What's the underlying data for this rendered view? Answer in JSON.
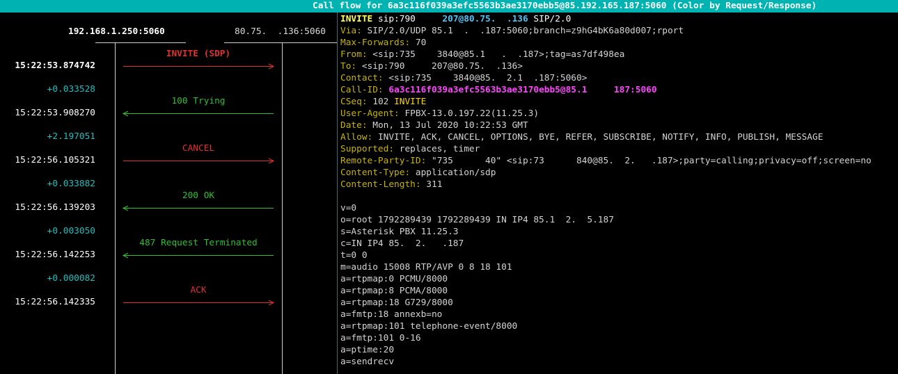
{
  "title": "Call flow for 6a3c116f039a3efc5563b3ae3170ebb5@85.192.165.187:5060 (Color by Request/Response)",
  "colors": {
    "title_bg": "#00b3b3",
    "request": "#e03030",
    "response": "#2ec02e",
    "delta": "#1fbfbf",
    "header_name": "#c8b400",
    "call_id": "#ff44ff"
  },
  "hosts": {
    "left": "192.168.1.250:5060",
    "right": "80.75.  .136:5060"
  },
  "flow": {
    "rows": [
      {
        "type": "label",
        "text": "INVITE (SDP)",
        "kind": "request",
        "bold": true
      },
      {
        "type": "time",
        "text": "15:22:53.874742",
        "bold": true
      },
      {
        "type": "arrow",
        "dir": "right",
        "kind": "request"
      },
      {
        "type": "delta",
        "text": "+0.033528"
      },
      {
        "type": "label",
        "text": "100 Trying",
        "kind": "response"
      },
      {
        "type": "time",
        "text": "15:22:53.908270"
      },
      {
        "type": "arrow",
        "dir": "left",
        "kind": "response"
      },
      {
        "type": "delta",
        "text": "+2.197051"
      },
      {
        "type": "label",
        "text": "CANCEL",
        "kind": "request"
      },
      {
        "type": "time",
        "text": "15:22:56.105321"
      },
      {
        "type": "arrow",
        "dir": "right",
        "kind": "request"
      },
      {
        "type": "delta",
        "text": "+0.033882"
      },
      {
        "type": "label",
        "text": "200 OK",
        "kind": "response"
      },
      {
        "type": "time",
        "text": "15:22:56.139203"
      },
      {
        "type": "arrow",
        "dir": "left",
        "kind": "response"
      },
      {
        "type": "delta",
        "text": "+0.003050"
      },
      {
        "type": "label",
        "text": "487 Request Terminated",
        "kind": "response"
      },
      {
        "type": "time",
        "text": "15:22:56.142253"
      },
      {
        "type": "arrow",
        "dir": "left",
        "kind": "response"
      },
      {
        "type": "delta",
        "text": "+0.000082"
      },
      {
        "type": "label",
        "text": "ACK",
        "kind": "request"
      },
      {
        "type": "time",
        "text": "15:22:56.142335"
      },
      {
        "type": "arrow",
        "dir": "right",
        "kind": "request"
      }
    ]
  },
  "sip": {
    "start_line": {
      "method": "INVITE",
      "uri_a": " sip:790     ",
      "uri_b": "207@80.75.  .136",
      "version": " SIP/2.0"
    },
    "headers": [
      {
        "name": "Via:",
        "value": " SIP/2.0/UDP 85.1  .  .187:5060;branch=z9hG4bK6a80d007;rport"
      },
      {
        "name": "Max-Forwards:",
        "value": " 70"
      },
      {
        "name": "From:",
        "value": " <sip:735    3840@85.1   .  .187>;tag=as7df498ea"
      },
      {
        "name": "To:",
        "value": " <sip:790     207@80.75.  .136>"
      },
      {
        "name": "Contact:",
        "value": " <sip:735    3840@85.  2.1  .187:5060>"
      },
      {
        "name": "Call-ID:",
        "value": " 6a3c116f039a3efc5563b3ae3170ebb5@85.1     187:5060",
        "style": "callid"
      },
      {
        "name": "CSeq:",
        "value": " 102 ",
        "method": "INVITE"
      },
      {
        "name": "User-Agent:",
        "value": " FPBX-13.0.197.22(11.25.3)"
      },
      {
        "name": "Date:",
        "value": " Mon, 13 Jul 2020 10:22:53 GMT"
      },
      {
        "name": "Allow:",
        "value": " INVITE, ACK, CANCEL, OPTIONS, BYE, REFER, SUBSCRIBE, NOTIFY, INFO, PUBLISH, MESSAGE"
      },
      {
        "name": "Supported:",
        "value": " replaces, timer"
      },
      {
        "name": "Remote-Party-ID:",
        "value": " \"735      40\" <sip:73      840@85.  2.   .187>;party=calling;privacy=off;screen=no"
      },
      {
        "name": "Content-Type:",
        "value": " application/sdp"
      },
      {
        "name": "Content-Length:",
        "value": " 311"
      }
    ],
    "sdp": [
      "",
      "v=0",
      "o=root 1792289439 1792289439 IN IP4 85.1  2.  5.187",
      "s=Asterisk PBX 11.25.3",
      "c=IN IP4 85.  2.   .187",
      "t=0 0",
      "m=audio 15008 RTP/AVP 0 8 18 101",
      "a=rtpmap:0 PCMU/8000",
      "a=rtpmap:8 PCMA/8000",
      "a=rtpmap:18 G729/8000",
      "a=fmtp:18 annexb=no",
      "a=rtpmap:101 telephone-event/8000",
      "a=fmtp:101 0-16",
      "a=ptime:20",
      "a=sendrecv"
    ]
  }
}
